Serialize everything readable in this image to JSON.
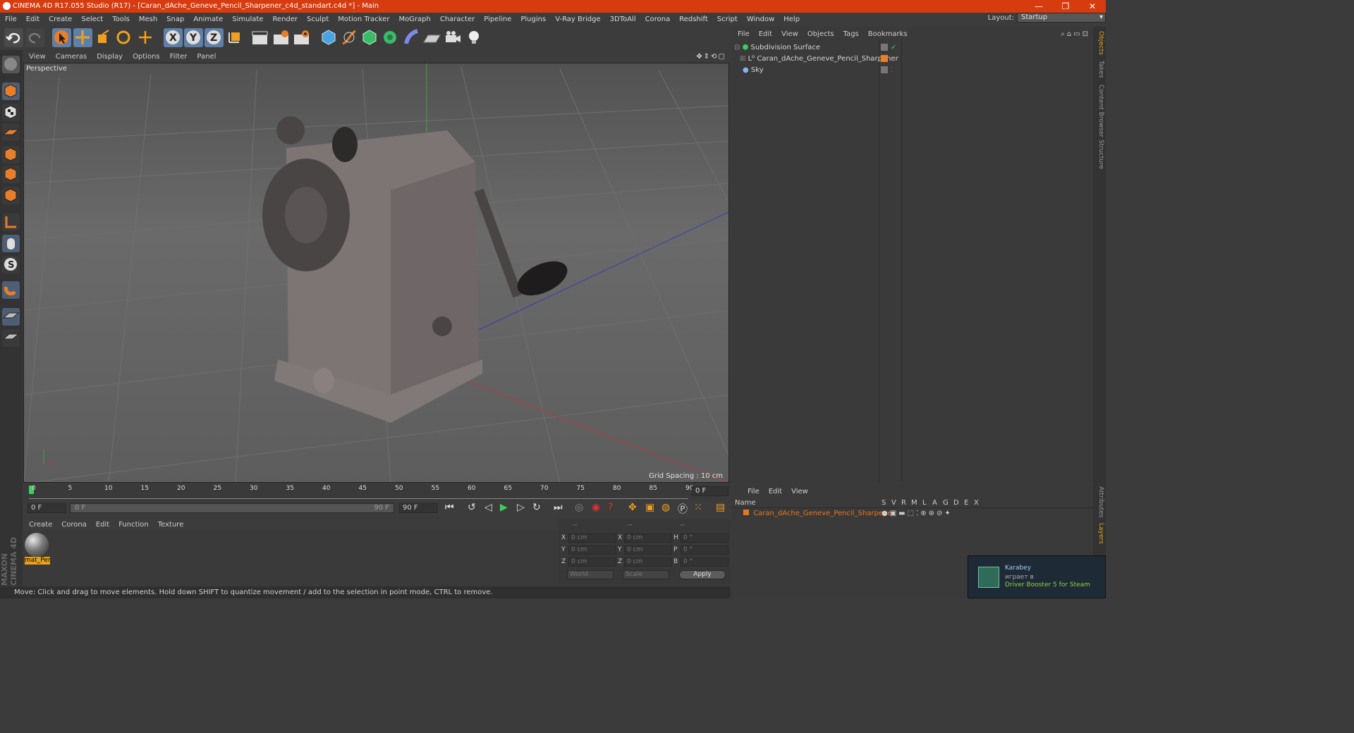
{
  "window": {
    "title": "CINEMA 4D R17.055 Studio (R17) - [Caran_dAche_Geneve_Pencil_Sharpener_c4d_standart.c4d *] - Main",
    "minimize": "—",
    "restore": "❐",
    "close": "✕"
  },
  "menubar": {
    "items": [
      "File",
      "Edit",
      "Create",
      "Select",
      "Tools",
      "Mesh",
      "Snap",
      "Animate",
      "Simulate",
      "Render",
      "Sculpt",
      "Motion Tracker",
      "MoGraph",
      "Character",
      "Pipeline",
      "Plugins",
      "V-Ray Bridge",
      "3DToAll",
      "Corona",
      "Redshift",
      "Script",
      "Window",
      "Help"
    ],
    "layout_label": "Layout:",
    "layout_value": "Startup"
  },
  "viewport": {
    "menu": [
      "View",
      "Cameras",
      "Display",
      "Options",
      "Filter",
      "Panel"
    ],
    "camera_label": "Perspective",
    "grid_spacing": "Grid Spacing : 10 cm"
  },
  "timeline": {
    "ticks": [
      "0",
      "5",
      "10",
      "15",
      "20",
      "25",
      "30",
      "35",
      "40",
      "45",
      "50",
      "55",
      "60",
      "65",
      "70",
      "75",
      "80",
      "85",
      "90"
    ],
    "current_frame": "0 F",
    "start_field": "0 F",
    "slider_start": "0 F",
    "slider_end": "90 F",
    "end_field": "90 F"
  },
  "materials": {
    "menu": [
      "Create",
      "Corona",
      "Edit",
      "Function",
      "Texture"
    ],
    "items": [
      {
        "label": "mat_Per"
      }
    ]
  },
  "coordinates": {
    "headers": [
      "--",
      "--",
      "--"
    ],
    "rows": [
      {
        "l1": "X",
        "v1": "0 cm",
        "l2": "X",
        "v2": "0 cm",
        "l3": "H",
        "v3": "0 °"
      },
      {
        "l1": "Y",
        "v1": "0 cm",
        "l2": "Y",
        "v2": "0 cm",
        "l3": "P",
        "v3": "0 °"
      },
      {
        "l1": "Z",
        "v1": "0 cm",
        "l2": "Z",
        "v2": "0 cm",
        "l3": "B",
        "v3": "0 °"
      }
    ],
    "world": "World",
    "scale": "Scale",
    "apply": "Apply"
  },
  "objects": {
    "menu": [
      "File",
      "Edit",
      "View",
      "Objects",
      "Tags",
      "Bookmarks"
    ],
    "rows": [
      {
        "name": "Subdivision Surface"
      },
      {
        "name": "Caran_dAche_Geneve_Pencil_Sharpener"
      },
      {
        "name": "Sky"
      }
    ]
  },
  "layers": {
    "menu": [
      "File",
      "Edit",
      "View"
    ],
    "columns": [
      "Name",
      "S",
      "V",
      "R",
      "M",
      "L",
      "A",
      "G",
      "D",
      "E",
      "X"
    ],
    "rows": [
      {
        "name": "Caran_dAche_Geneve_Pencil_Sharpener"
      }
    ]
  },
  "side_tabs": [
    "Objects",
    "Takes",
    "Content Browser",
    "Structure",
    "Attributes",
    "Layers"
  ],
  "brand": "MAXON CINEMA 4D",
  "status": "Move: Click and drag to move elements. Hold down SHIFT to quantize movement / add to the selection in point mode, CTRL to remove.",
  "notification": {
    "user": "Karabey",
    "action": "играет в",
    "game": "Driver Booster 5 for Steam"
  },
  "colors": {
    "title_bar": "#d63c0f",
    "accent_orange": "#e87d2a",
    "active_blue": "#5d7fa8",
    "layer_orange": "#e8751a"
  }
}
